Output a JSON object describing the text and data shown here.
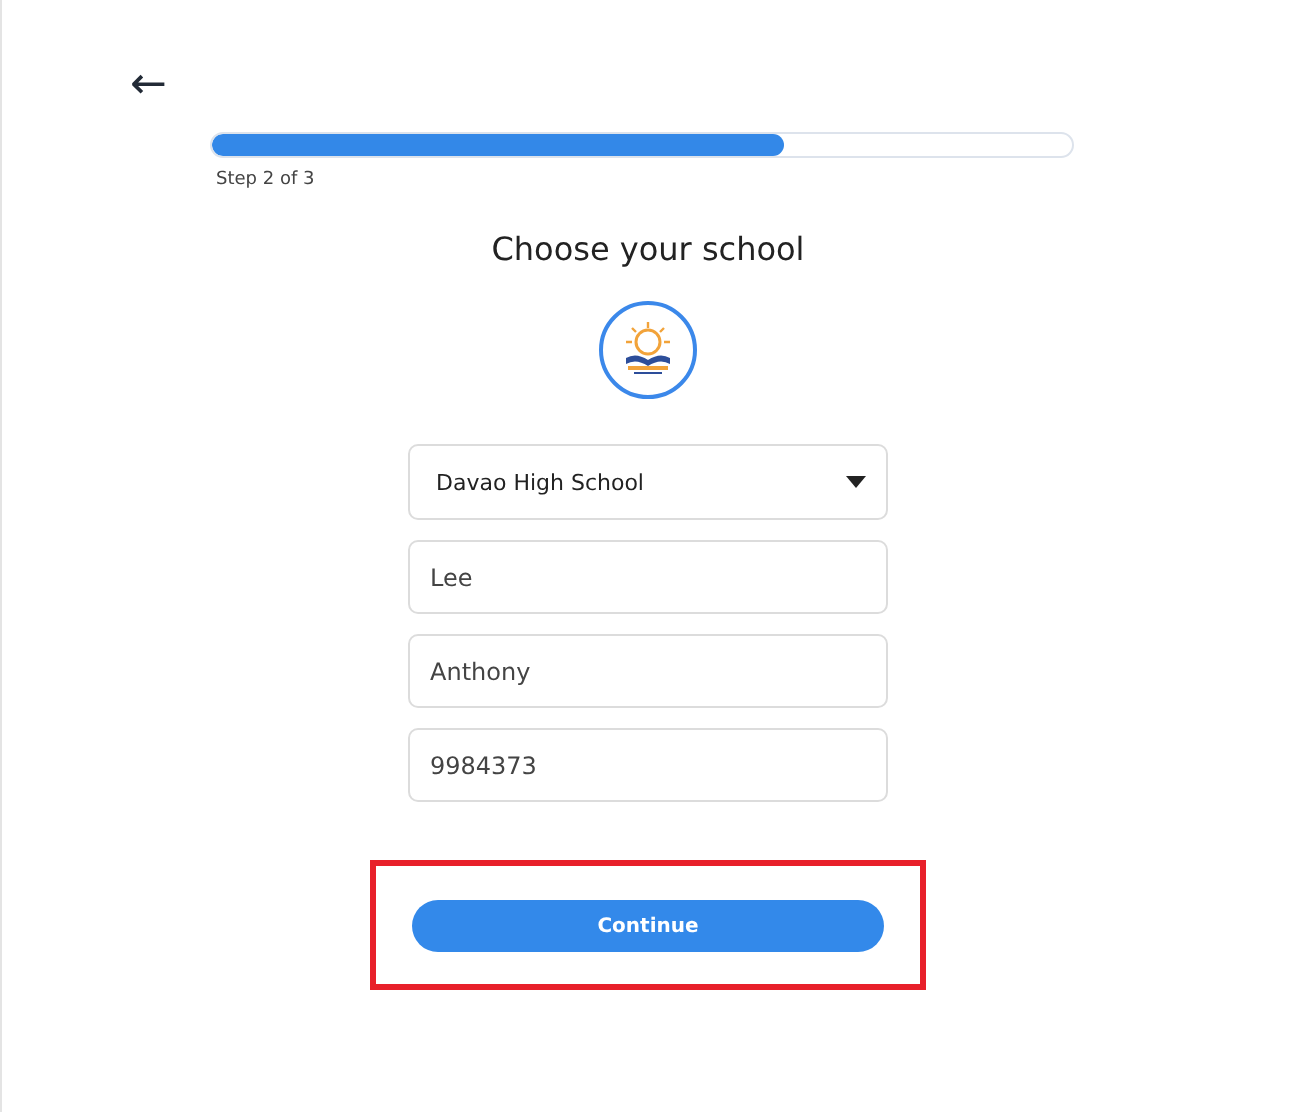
{
  "back": {
    "label": "←"
  },
  "progress": {
    "level": 0.664,
    "caption": "Step 2 of 3"
  },
  "title": "Choose your school",
  "school_select": {
    "value": "Davao High School"
  },
  "fields": [
    {
      "value": "Lee"
    },
    {
      "value": "Anthony"
    },
    {
      "value": "9984373"
    }
  ],
  "continue_button": {
    "label": "Continue",
    "highlighted": true
  }
}
